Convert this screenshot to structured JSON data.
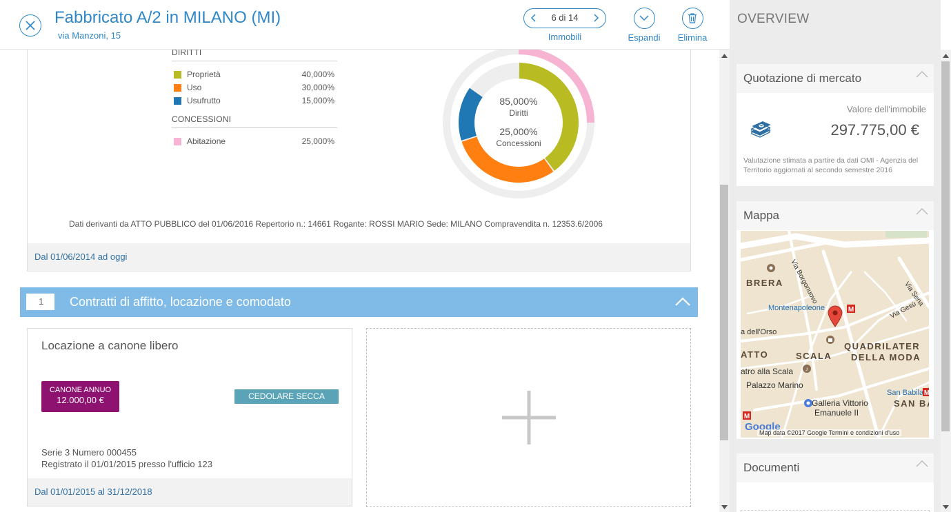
{
  "header": {
    "title": "Fabbricato A/2 in MILANO (MI)",
    "subtitle": "via Manzoni, 15",
    "pager_text": "6 di 14",
    "pager_label": "Immobili",
    "expand_label": "Espandi",
    "delete_label": "Elimina"
  },
  "rights": {
    "diritti_label": "DIRITTI",
    "items": [
      {
        "name": "Proprietà",
        "pct": "40,000%",
        "color": "#b8bc22"
      },
      {
        "name": "Uso",
        "pct": "30,000%",
        "color": "#ff8010"
      },
      {
        "name": "Usufrutto",
        "pct": "15,000%",
        "color": "#1f77b4"
      }
    ],
    "concessioni_label": "CONCESSIONI",
    "concessions": [
      {
        "name": "Abitazione",
        "pct": "25,000%",
        "color": "#f7b3d2"
      }
    ]
  },
  "donut": {
    "diritti_pct": "85,000%",
    "diritti_label": "Diritti",
    "concessioni_pct": "25,000%",
    "concessioni_label": "Concessioni",
    "values": {
      "proprieta": 40,
      "uso": 30,
      "usufrutto": 15,
      "abitazione": 25
    }
  },
  "source_note": "Dati derivanti da ATTO PUBBLICO del 01/06/2016 Repertorio n.: 14661 Rogante: ROSSI MARIO Sede: MILANO Compravendita n. 12353.6/2006",
  "rights_period": "Dal 01/06/2014 ad oggi",
  "contracts_section": {
    "count": "1",
    "title": "Contratti di affitto, locazione e comodato"
  },
  "contract": {
    "title": "Locazione a canone libero",
    "badge_label": "CANONE ANNUO",
    "badge_value": "12.000,00 €",
    "tag": "CEDOLARE SECCA",
    "line1": "Serie 3 Numero 000455",
    "line2": "Registrato il 01/01/2015 presso l'ufficio 123",
    "period": "Dal 01/01/2015 al 31/12/2018"
  },
  "overview": {
    "title": "OVERVIEW",
    "quotazione": {
      "title": "Quotazione di mercato",
      "value_label": "Valore dell'immobile",
      "value": "297.775,00 €",
      "note": "Valutazione stimata a partire da dati OMI - Agenzia del Territorio aggiornati al secondo semestre 2016"
    },
    "mappa": {
      "title": "Mappa",
      "labels": {
        "brera": "BRERA",
        "borgonuovo": "Via Borgonuovo",
        "montenapoleone": "Montenapoleone",
        "gesu": "Via Gesù",
        "senato": "Via Sena",
        "orso": "a dell'Orso",
        "atto": "ATTO",
        "scala": "SCALA",
        "quadrilatero1": "QUADRILATER",
        "quadrilatero2": "DELLA MODA",
        "teatro": "atro alla Scala",
        "palazzo": "Palazzo Marino",
        "galleria1": "Galleria Vittorio",
        "galleria2": "Emanuele II",
        "babila_stop": "San Babila",
        "san_babila": "SAN BA",
        "google": "Google",
        "attribution": "Map data ©2017 Google   Termini e condizioni d'uso"
      }
    },
    "documenti": {
      "title": "Documenti"
    }
  }
}
